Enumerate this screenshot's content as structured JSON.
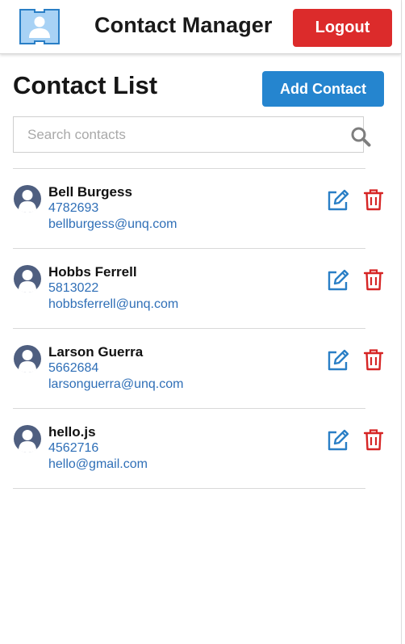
{
  "header": {
    "app_title": "Contact Manager",
    "logout_label": "Logout",
    "logo_icon": "contact-card-icon"
  },
  "main": {
    "title": "Contact List",
    "add_label": "Add Contact",
    "search": {
      "placeholder": "Search contacts",
      "value": ""
    }
  },
  "contacts": [
    {
      "name": "Bell Burgess",
      "phone": "4782693",
      "email": "bellburgess@unq.com"
    },
    {
      "name": "Hobbs Ferrell",
      "phone": "5813022",
      "email": "hobbsferrell@unq.com"
    },
    {
      "name": "Larson Guerra",
      "phone": "5662684",
      "email": "larsonguerra@unq.com"
    },
    {
      "name": "hello.js",
      "phone": "4562716",
      "email": "hello@gmail.com"
    }
  ],
  "icons": {
    "edit": "edit-icon",
    "delete": "trash-icon",
    "avatar": "user-avatar-icon",
    "search": "search-icon"
  },
  "colors": {
    "logout": "#dc2b2b",
    "primary": "#2585cf",
    "link": "#2f6fb7",
    "danger": "#d62525",
    "avatar": "#4f5f80"
  }
}
